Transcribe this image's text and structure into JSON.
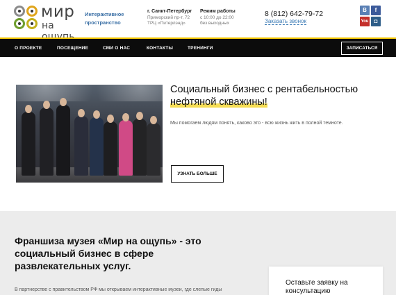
{
  "header": {
    "logo_line1": "мир",
    "logo_line2": "на ощупь",
    "tagline": "Интерактивное пространство",
    "city": {
      "name": "г. Санкт-Петербург",
      "address": "Приморский пр-т, 72",
      "mall": "ТРЦ «Питерлэнд»"
    },
    "hours": {
      "title": "Режим работы",
      "time": "с 10:00 до 22:00",
      "note": "без выходных"
    },
    "phone": "8 (812) 642-79-72",
    "callback": "Заказать звонок",
    "socials": {
      "vk": "В",
      "fb": "f",
      "yt": "You",
      "ig": "◘"
    }
  },
  "nav": {
    "items": [
      "О ПРОЕКТЕ",
      "ПОСЕЩЕНИЕ",
      "СМИ О НАС",
      "КОНТАКТЫ",
      "ТРЕНИНГИ"
    ],
    "cta": "ЗАПИСАТЬСЯ"
  },
  "hero": {
    "title_part1": "Социальный бизнес с рентабельностью",
    "title_part2": "нефтяной скважины!",
    "text": "Мы помогаем людям понять, каково это - всю жизнь жить в полной темноте.",
    "button": "УЗНАТЬ БОЛЬШЕ"
  },
  "franchise": {
    "title": "Франшиза музея «Мир на ощупь» - это социальный бизнес в сфере развлекательных услуг.",
    "text": "В партнерстве с правительством РФ мы открываем интерактивные музеи, где слепые гиды",
    "form_title": "Оставьте заявку на консультацию"
  },
  "colors": {
    "accent_yellow": "#f2c500",
    "nav_bg": "#0c0c0c",
    "link_blue": "#3a7ab5",
    "section_gray": "#ececec"
  }
}
